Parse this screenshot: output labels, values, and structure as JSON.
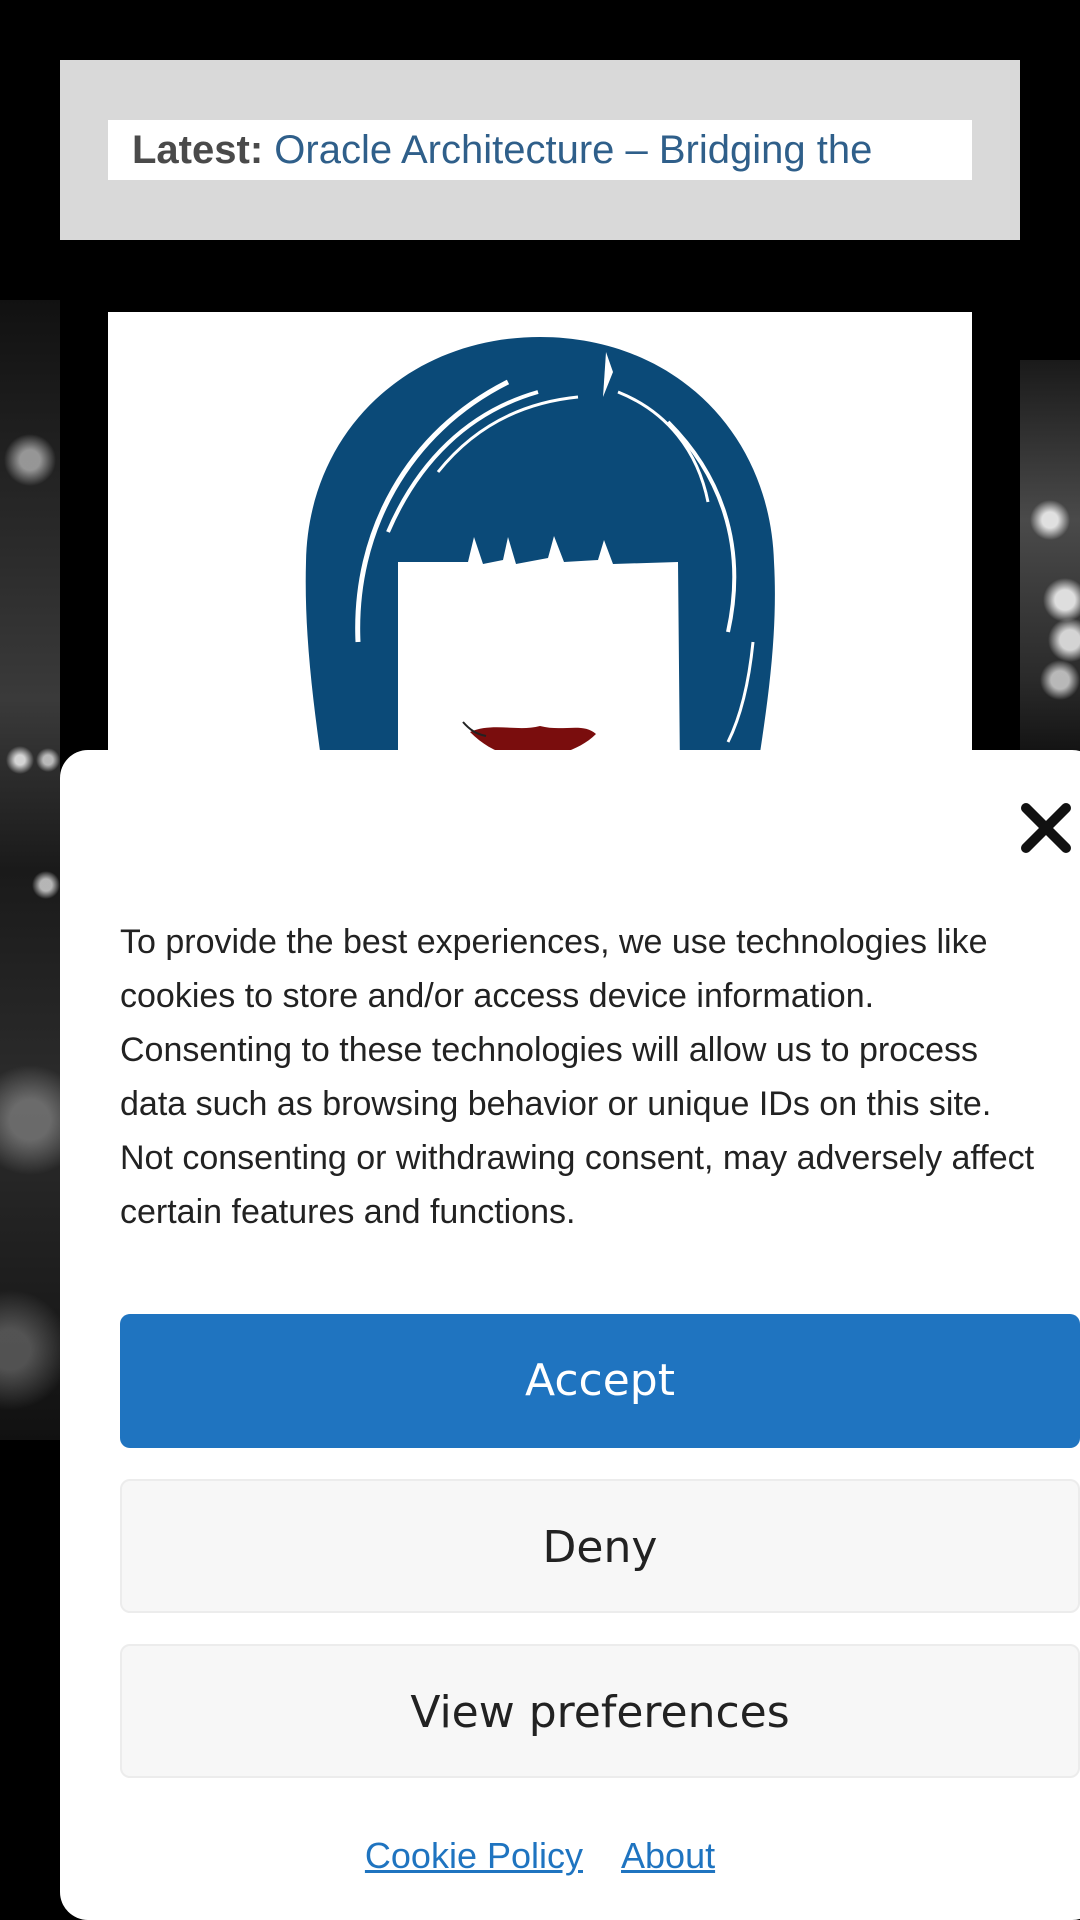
{
  "ticker": {
    "label": "Latest:",
    "headline": "Oracle Architecture – Bridging the"
  },
  "logo": {
    "icon": "woman-with-bob-haircut-logo",
    "hair_color": "#0b4a78",
    "lip_color": "#7a0d0d"
  },
  "cookie_banner": {
    "close_icon": "close-x-icon",
    "message": "To provide the best experiences, we use technologies like cookies to store and/or access device information. Consenting to these technologies will allow us to process data such as browsing behavior or unique IDs on this site. Not consenting or withdrawing consent, may adversely affect certain features and functions.",
    "accept_label": "Accept",
    "deny_label": "Deny",
    "preferences_label": "View preferences",
    "links": {
      "cookie_policy": "Cookie Policy",
      "about": "About"
    },
    "accent_color": "#1f74c0"
  }
}
